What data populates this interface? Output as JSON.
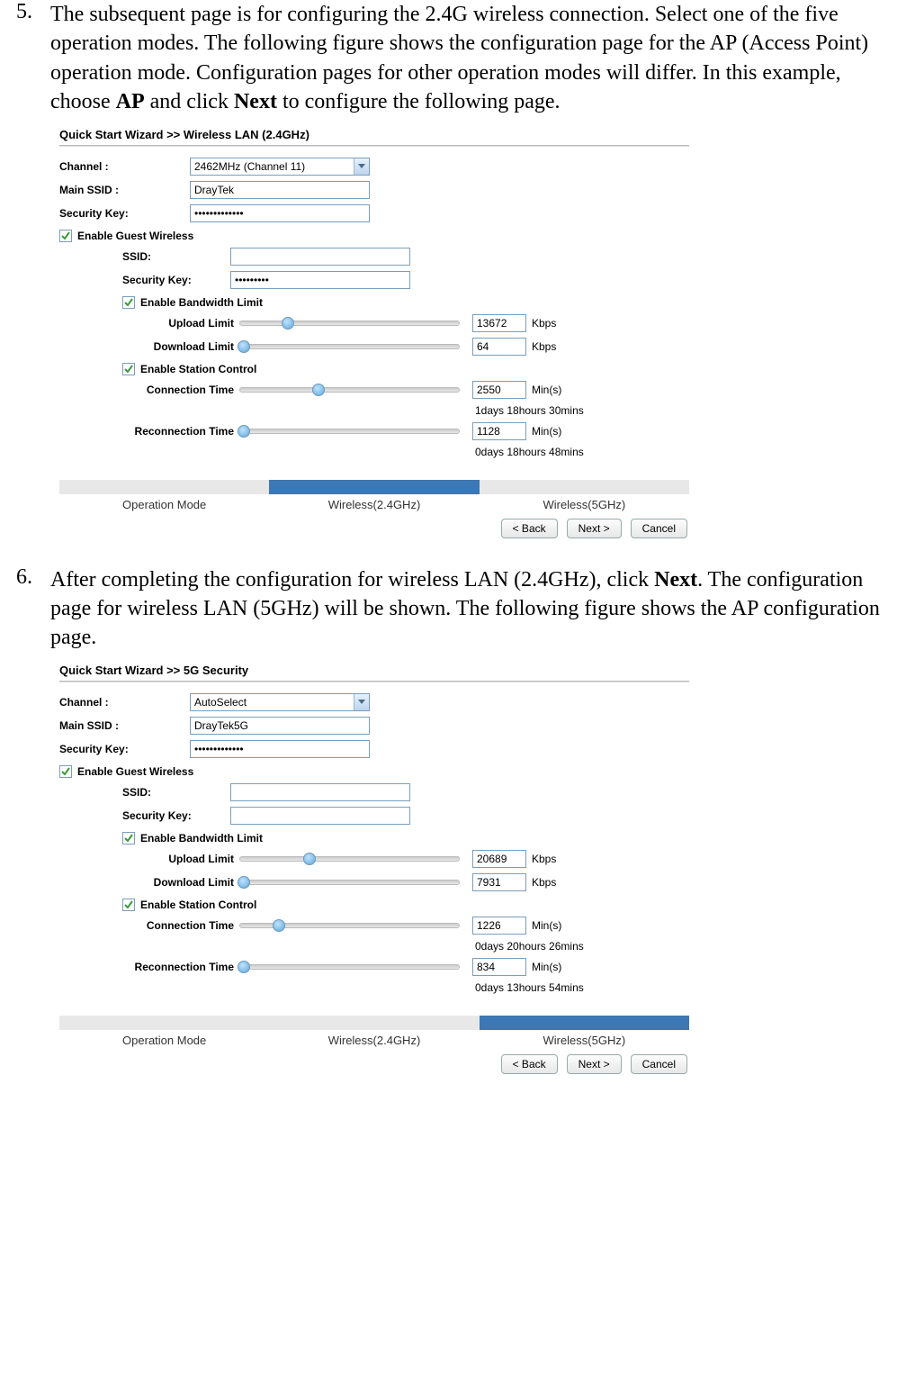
{
  "step5": {
    "num": "5.",
    "text_a": "The subsequent page is for configuring the 2.4G wireless connection. Select one of the five operation modes. The following figure shows the configuration page for the AP (Access Point) operation mode. Configuration pages for other operation modes will differ. In this example, choose ",
    "text_b": "AP",
    "text_c": " and click ",
    "text_d": "Next",
    "text_e": " to configure the following page."
  },
  "step6": {
    "num": "6.",
    "text_a": "After completing the configuration for wireless LAN (2.4GHz), click ",
    "text_b": "Next",
    "text_c": ". The configuration page for wireless LAN (5GHz) will be shown. The following figure shows the AP configuration page."
  },
  "panel1": {
    "title": "Quick Start Wizard >> Wireless LAN (2.4GHz)",
    "labels": {
      "channel": "Channel :",
      "main_ssid": "Main SSID :",
      "security_key": "Security Key:",
      "enable_guest": "Enable Guest Wireless",
      "guest_ssid": "SSID:",
      "guest_sec": "Security Key:",
      "enable_bw": "Enable Bandwidth Limit",
      "upload": "Upload Limit",
      "download": "Download Limit",
      "enable_station": "Enable Station Control",
      "conn_time": "Connection Time",
      "reconn_time": "Reconnection Time"
    },
    "values": {
      "channel": "2462MHz (Channel 11)",
      "main_ssid": "DrayTek",
      "security_key": "•••••••••••••",
      "guest_ssid": "",
      "guest_sec": "•••••••••",
      "upload": "13672",
      "download": "64",
      "conn_time": "2550",
      "conn_hint": "1days 18hours 30mins",
      "reconn_time": "1128",
      "reconn_hint": "0days 18hours 48mins"
    },
    "units": {
      "kbps": "Kbps",
      "mins": "Min(s)"
    },
    "slider_pos": {
      "upload": 22,
      "download": 0,
      "conn": 36,
      "reconn": 0
    },
    "steps": {
      "op": "Operation Mode",
      "w24": "Wireless(2.4GHz)",
      "w5": "Wireless(5GHz)",
      "active": 2
    },
    "buttons": {
      "back": "< Back",
      "next": "Next >",
      "cancel": "Cancel"
    }
  },
  "panel2": {
    "title": "Quick Start Wizard >> 5G Security",
    "labels": {
      "channel": "Channel :",
      "main_ssid": "Main SSID :",
      "security_key": "Security Key:",
      "enable_guest": "Enable Guest Wireless",
      "guest_ssid": "SSID:",
      "guest_sec": "Security Key:",
      "enable_bw": "Enable Bandwidth Limit",
      "upload": "Upload Limit",
      "download": "Download Limit",
      "enable_station": "Enable Station Control",
      "conn_time": "Connection Time",
      "reconn_time": "Reconnection Time"
    },
    "values": {
      "channel": "AutoSelect",
      "main_ssid": "DrayTek5G",
      "security_key": "•••••••••••••",
      "guest_ssid": "",
      "guest_sec": "",
      "upload": "20689",
      "download": "7931",
      "conn_time": "1226",
      "conn_hint": "0days 20hours 26mins",
      "reconn_time": "834",
      "reconn_hint": "0days 13hours 54mins"
    },
    "units": {
      "kbps": "Kbps",
      "mins": "Min(s)"
    },
    "slider_pos": {
      "upload": 32,
      "download": 0,
      "conn": 18,
      "reconn": 0
    },
    "steps": {
      "op": "Operation Mode",
      "w24": "Wireless(2.4GHz)",
      "w5": "Wireless(5GHz)",
      "active": 3
    },
    "buttons": {
      "back": "< Back",
      "next": "Next >",
      "cancel": "Cancel"
    }
  }
}
